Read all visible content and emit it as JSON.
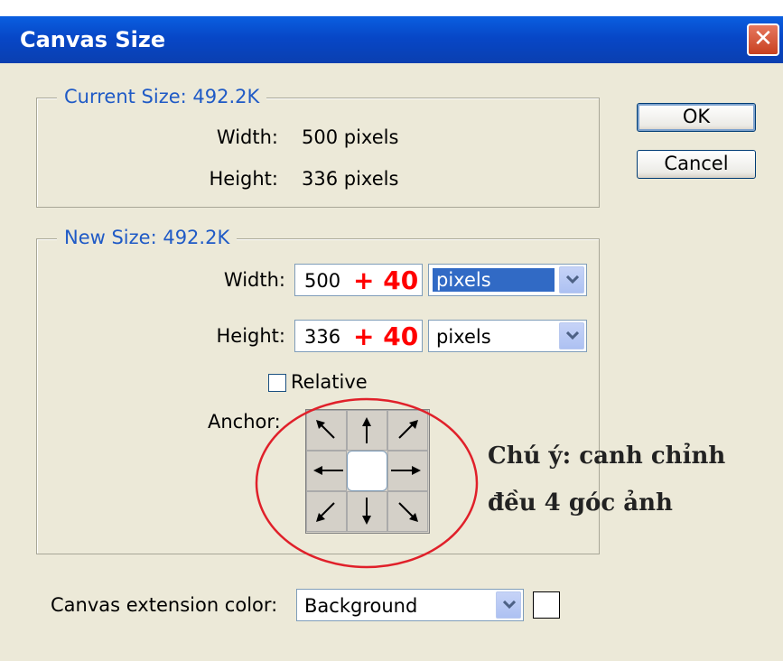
{
  "window": {
    "title": "Canvas Size"
  },
  "current_size": {
    "legend": "Current Size: 492.2K",
    "width_label": "Width:",
    "width_value": "500 pixels",
    "height_label": "Height:",
    "height_value": "336 pixels"
  },
  "new_size": {
    "legend": "New Size: 492.2K",
    "width_label": "Width:",
    "width_value": "500",
    "width_add": "+ 40",
    "width_unit": "pixels",
    "height_label": "Height:",
    "height_value": "336",
    "height_add": "+ 40",
    "height_unit": "pixels",
    "relative_label": "Relative",
    "relative_checked": false,
    "anchor_label": "Anchor:"
  },
  "buttons": {
    "ok": "OK",
    "cancel": "Cancel"
  },
  "extension": {
    "label": "Canvas extension color:",
    "value": "Background",
    "swatch_color": "#ffffff"
  },
  "annotation": {
    "line1": "Chú ý: canh chỉnh",
    "line2": "đều 4 góc ảnh",
    "circle_color": "#e0202a",
    "add_color": "#ff0000"
  },
  "icons": [
    "close-icon",
    "chevron-down-icon",
    "arrow-nw-icon",
    "arrow-n-icon",
    "arrow-ne-icon",
    "arrow-w-icon",
    "arrow-e-icon",
    "arrow-sw-icon",
    "arrow-s-icon",
    "arrow-se-icon"
  ]
}
